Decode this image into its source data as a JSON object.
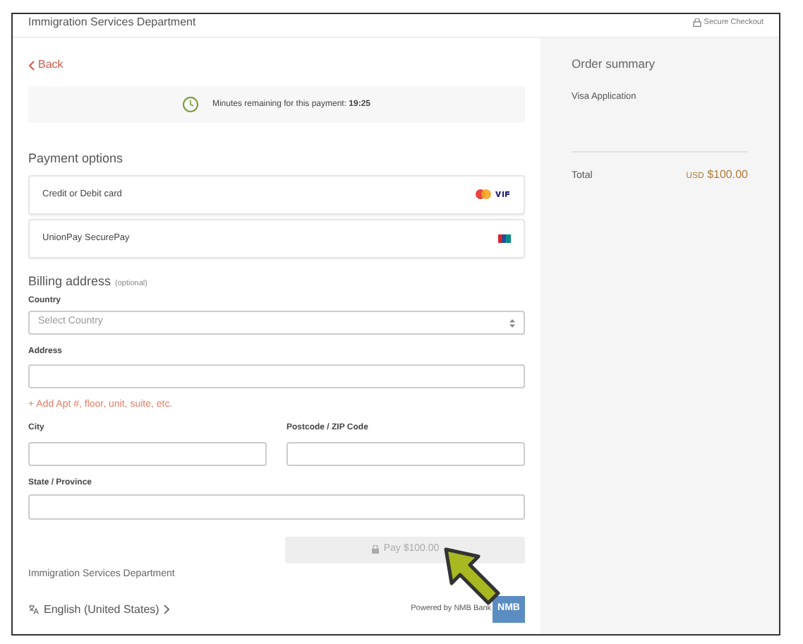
{
  "header": {
    "title": "Immigration Services Department",
    "secure": "Secure Checkout"
  },
  "back": "Back",
  "timer": {
    "text": "Minutes remaining for this payment: **19:25**"
  },
  "payment_options": {
    "heading": "Payment options",
    "options": [
      {
        "label": "Credit or Debit card",
        "kind": "card"
      },
      {
        "label": "UnionPay SecurePay",
        "kind": "unionpay"
      }
    ]
  },
  "billing": {
    "heading": "Billing address",
    "note": "(optional)",
    "country": {
      "label": "Country",
      "placeholder": "Select Country"
    },
    "address": {
      "label": "Address"
    },
    "add_line": "+ Add Apt #, floor, unit, suite, etc.",
    "city": {
      "label": "City"
    },
    "postcode": {
      "label": "Postcode / ZIP Code"
    },
    "state": {
      "label": "State / Province"
    }
  },
  "pay_button": {
    "label": "Pay $100.00",
    "disabled": true
  },
  "footer": {
    "merchant": "Immigration Services Department",
    "language": "English (United States)",
    "powered_by": "Powered by NMB Bank",
    "logo": "NMB"
  },
  "summary": {
    "heading": "Order summary",
    "item": "Visa Application",
    "total_label": "Total",
    "currency": "USD",
    "total": "$100.00"
  }
}
